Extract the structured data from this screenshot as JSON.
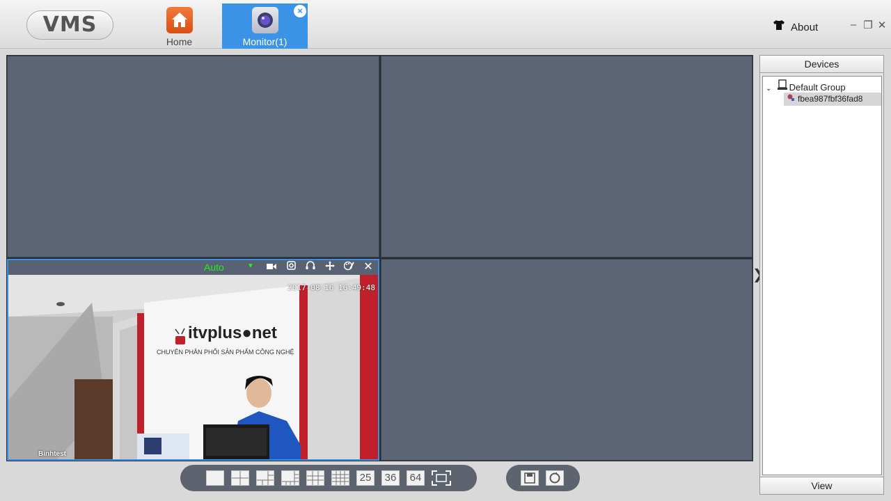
{
  "app": {
    "logo_text": "VMS"
  },
  "tabs": [
    {
      "label": "Home",
      "icon": "house-icon"
    },
    {
      "label": "Monitor(1)",
      "icon": "camera-lens-icon",
      "active": true
    }
  ],
  "header": {
    "about_label": "About",
    "minimize": "–",
    "restore": "❐",
    "close": "✕"
  },
  "video_cell": {
    "quality": "Auto",
    "toolbar_icons": [
      "record-icon",
      "snapshot-icon",
      "audio-icon",
      "ptz-icon",
      "image-settings-icon",
      "close-icon"
    ],
    "timestamp": "2017-08-16 16:49:48",
    "camera_name": "Binhtest",
    "wall_brand": "itvplus●net",
    "wall_subtitle": "CHUYÊN PHÂN PHỐI SẢN PHẨM CÔNG NGHỆ"
  },
  "devices": {
    "header": "Devices",
    "group": "Default Group",
    "device": "fbea987fbf36fad8",
    "footer": "View"
  },
  "layout_buttons": [
    "1",
    "4",
    "6",
    "8",
    "9",
    "16",
    "25",
    "36",
    "64",
    "fullscreen"
  ],
  "action_buttons": [
    "save-icon",
    "cycle-icon"
  ],
  "colors": {
    "accent": "#3a93e6",
    "cell": "#5b6575",
    "quality": "#22ee22"
  }
}
